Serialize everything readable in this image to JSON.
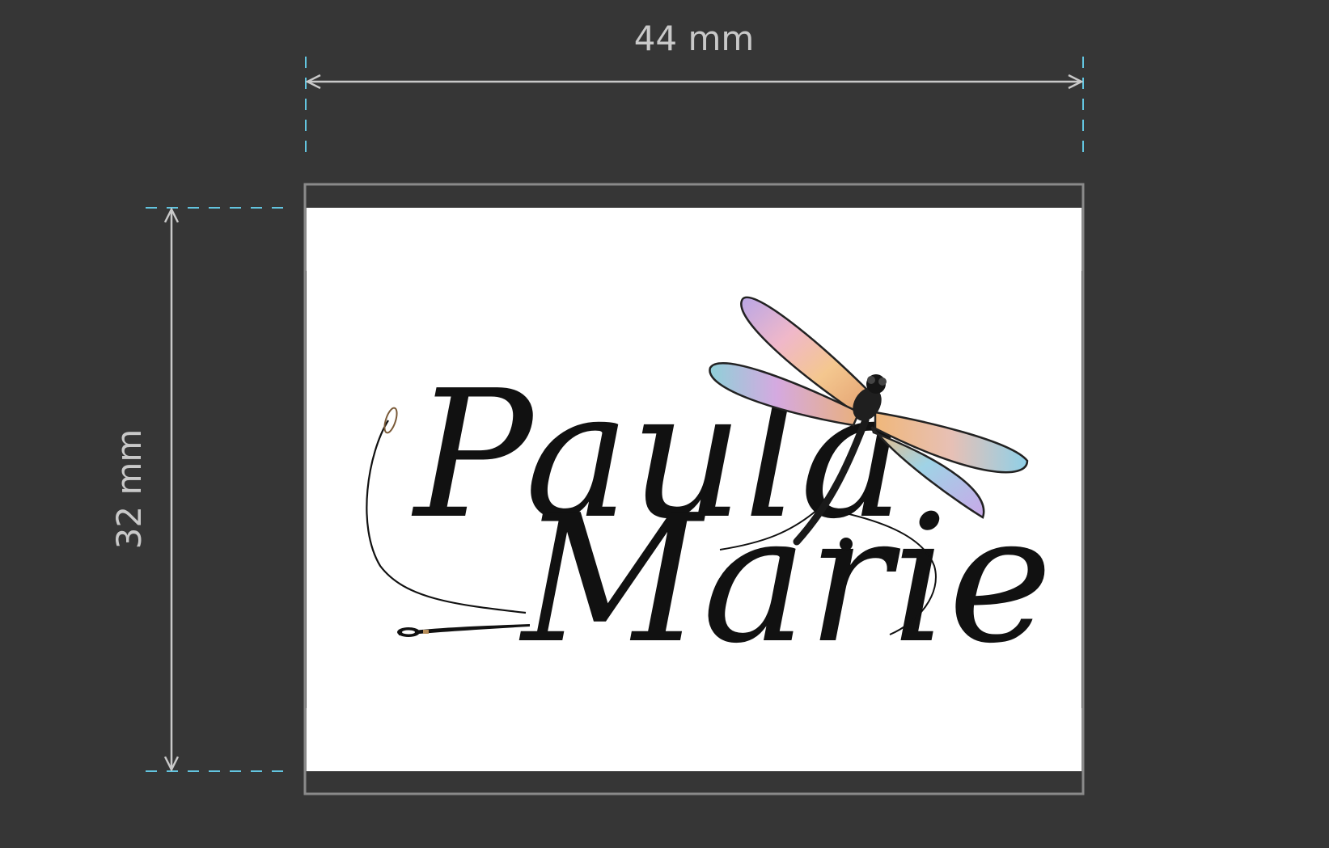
{
  "dimensions": {
    "width_label": "44 mm",
    "height_label": "32 mm"
  },
  "label": {
    "line1": "Paula",
    "line2": "Marie",
    "background_color": "#ffffff",
    "frame_color": "#8a8a8a"
  },
  "colors": {
    "background": "#363636",
    "dimension_line": "#c9c9c9",
    "guide_dashes": "#63c5e0",
    "ink": "#111111"
  },
  "icons": [
    "dragonfly-icon",
    "needle-icon"
  ]
}
